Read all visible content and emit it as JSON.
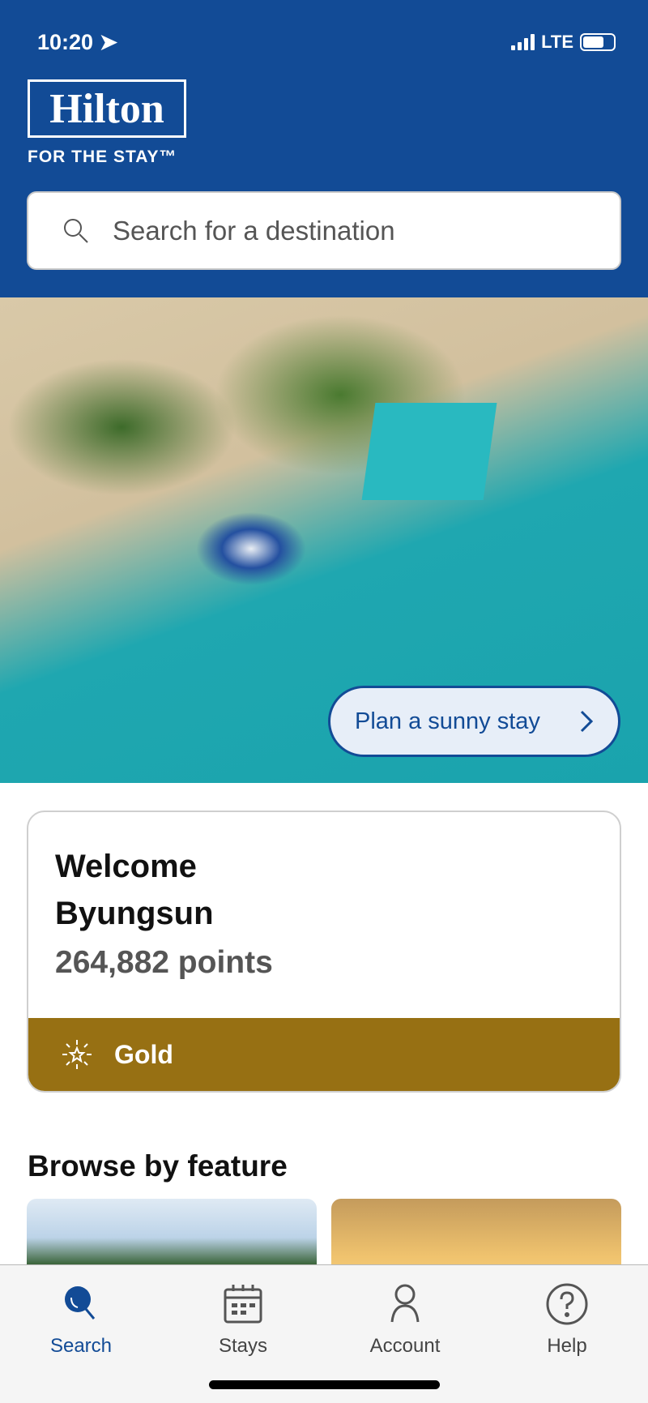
{
  "status_bar": {
    "time": "10:20",
    "network": "LTE"
  },
  "brand": {
    "logo_text": "Hilton",
    "tagline": "FOR THE STAY™",
    "color": "#124b96"
  },
  "search": {
    "placeholder": "Search for a destination"
  },
  "hero": {
    "cta_label": "Plan a sunny stay"
  },
  "welcome": {
    "greeting": "Welcome",
    "name": "Byungsun",
    "points": "264,882 points",
    "tier": "Gold",
    "tier_color": "#977013"
  },
  "browse": {
    "title": "Browse by feature"
  },
  "nav": {
    "items": [
      {
        "label": "Search",
        "icon": "search-icon",
        "active": true
      },
      {
        "label": "Stays",
        "icon": "calendar-icon"
      },
      {
        "label": "Account",
        "icon": "person-icon"
      },
      {
        "label": "Help",
        "icon": "help-icon"
      }
    ]
  }
}
